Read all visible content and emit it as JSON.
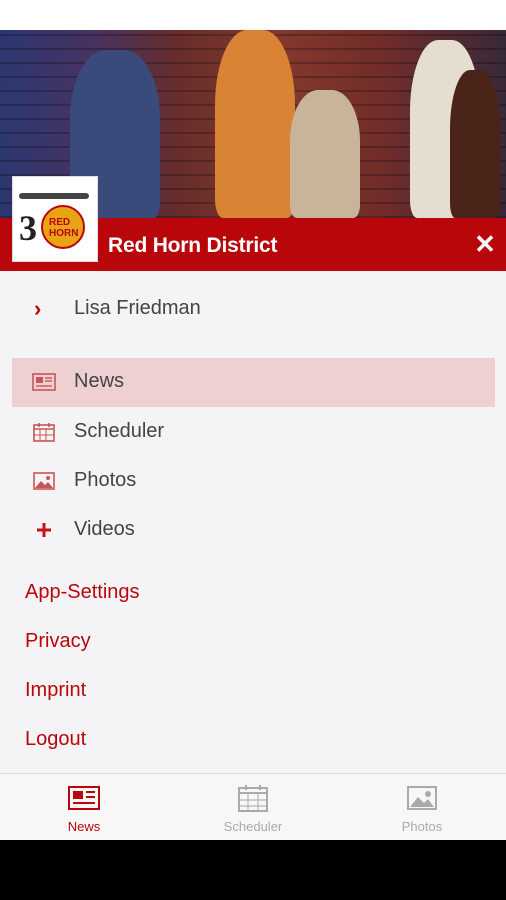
{
  "header": {
    "app_title": "Red Horn District",
    "close_symbol": "✕",
    "logo_text": "RED HORN",
    "logo_number": "3",
    "hero_image": "band-photo"
  },
  "user": {
    "name": "Lisa Friedman",
    "icon": "chevron-right-icon"
  },
  "menu": {
    "items": [
      {
        "label": "News",
        "icon": "newspaper-icon",
        "active": true
      },
      {
        "label": "Scheduler",
        "icon": "calendar-icon",
        "active": false
      },
      {
        "label": "Photos",
        "icon": "image-icon",
        "active": false
      },
      {
        "label": "Videos",
        "icon": "plus-icon",
        "active": false
      }
    ]
  },
  "links": {
    "app_settings": "App-Settings",
    "privacy": "Privacy",
    "imprint": "Imprint",
    "logout": "Logout"
  },
  "bottom_nav": {
    "tabs": [
      {
        "label": "News",
        "icon": "newspaper-icon",
        "active": true
      },
      {
        "label": "Scheduler",
        "icon": "calendar-icon",
        "active": false
      },
      {
        "label": "Photos",
        "icon": "image-icon",
        "active": false
      }
    ]
  },
  "colors": {
    "accent": "#b8060b",
    "active_bg": "#efd0d2",
    "text": "#444444",
    "inactive": "#aaaaaa"
  }
}
